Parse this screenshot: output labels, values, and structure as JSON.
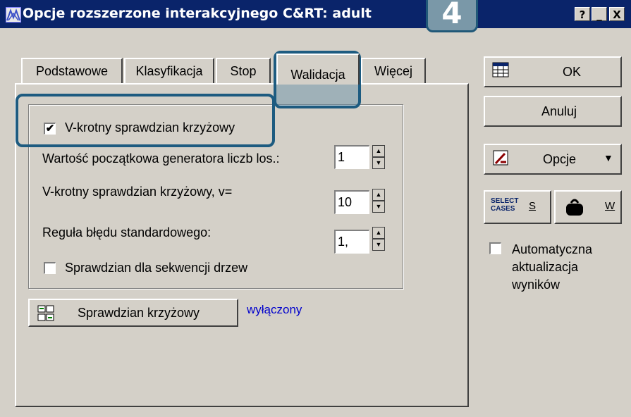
{
  "window": {
    "title": "Opcje rozszerzone interakcyjnego C&RT: adult",
    "controls": {
      "help": "?",
      "minimize": "_",
      "close": "X"
    }
  },
  "badge": "4",
  "tabs": [
    {
      "label": "Podstawowe"
    },
    {
      "label": "Klasyfikacja"
    },
    {
      "label": "Stop"
    },
    {
      "label": "Walidacja",
      "active": true
    },
    {
      "label": "Więcej"
    }
  ],
  "validation": {
    "vfold_checkbox": {
      "label": "V-krotny sprawdzian krzyżowy",
      "checked": true,
      "mark": "✔"
    },
    "seed": {
      "label": "Wartość początkowa generatora liczb los.:",
      "value": "1"
    },
    "vfold_v": {
      "label": "V-krotny sprawdzian krzyżowy, v=",
      "value": "10"
    },
    "se_rule": {
      "label": "Reguła błędu standardowego:",
      "value": "1,"
    },
    "tree_seq_checkbox": {
      "label": "Sprawdzian dla sekwencji drzew",
      "checked": false
    },
    "cv_button": {
      "label": "Sprawdzian krzyżowy"
    },
    "cv_status": "wyłączony"
  },
  "side": {
    "ok": "OK",
    "cancel": "Anuluj",
    "options": "Opcje",
    "select_cases_icon_text": "SELECT CASES",
    "select_cases_key": "S",
    "weight_key": "W",
    "auto_update_checkbox": {
      "label": "Automatyczna aktualizacja wyników",
      "checked": false
    }
  },
  "colors": {
    "title_bar": "#0a246a",
    "highlight_border": "#1d5b80",
    "status_text": "#0000cc"
  }
}
